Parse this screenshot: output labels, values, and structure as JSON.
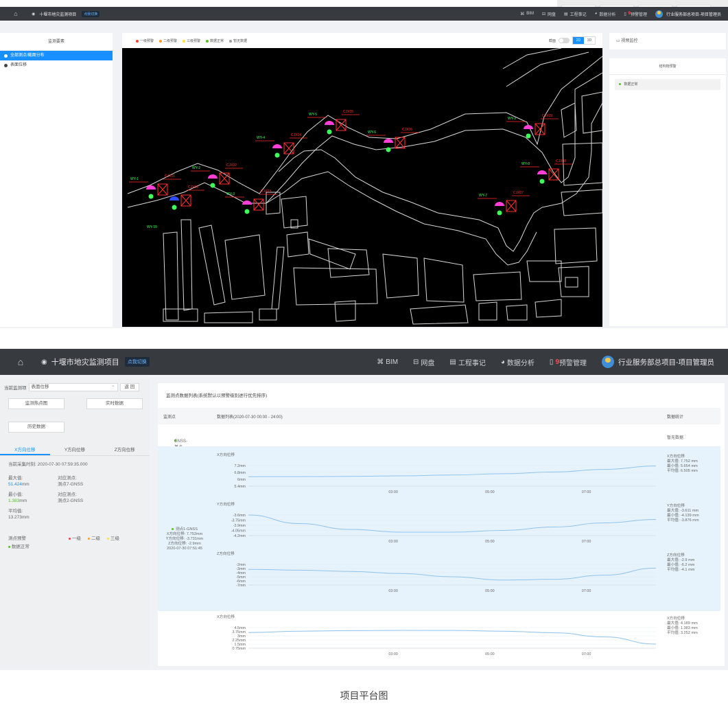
{
  "topbar": {
    "project": "十堰市地灾监测项目",
    "switch": "点我切换",
    "nav": [
      {
        "icon": "bim-icon",
        "glyph": "⌘",
        "label": "BIM"
      },
      {
        "icon": "cloud-disk-icon",
        "glyph": "⊟",
        "label": "网盘"
      },
      {
        "icon": "calendar-icon",
        "glyph": "▤",
        "label": "工程事记"
      },
      {
        "icon": "pie-chart-icon",
        "glyph": "◕",
        "label": "数据分析"
      },
      {
        "icon": "bell-icon",
        "glyph": "▯",
        "label": "预警管理",
        "badge": "9"
      }
    ],
    "user": "行业服务部总项目-项目管理员"
  },
  "screen1": {
    "left_header": "监测要素",
    "left_items": [
      {
        "label": "全部测点/截面分布",
        "active": true
      },
      {
        "label": "表面位移",
        "active": false
      }
    ],
    "legend": [
      {
        "label": "一级预警",
        "color": "#ff3b3b"
      },
      {
        "label": "二级预警",
        "color": "#ff9c1a"
      },
      {
        "label": "三级预警",
        "color": "#ffe23a"
      },
      {
        "label": "数据正常",
        "color": "#52c41a"
      },
      {
        "label": "暂无数据",
        "color": "#9aa0a6"
      }
    ],
    "section_toggle": "截面",
    "view_2d": "2D",
    "view_3d": "3D",
    "video": "视频监控",
    "right_panel_title": "结构物预警",
    "right_item": "数据正常",
    "map_points": [
      {
        "wy": "WY-1",
        "cj": "CJX01"
      },
      {
        "wy": "WY-2",
        "cj": "CJX02"
      },
      {
        "wy": "WY-3",
        "cj": "CJX03"
      },
      {
        "wy": "WY-4",
        "cj": "CJX04"
      },
      {
        "wy": "WY-5",
        "cj": "CJX05"
      },
      {
        "wy": "WY-6",
        "cj": "CJX06"
      },
      {
        "wy": "WY-7",
        "cj": "CJX07"
      },
      {
        "wy": "WY-8",
        "cj": "CJX08"
      },
      {
        "wy": "WY-9",
        "cj": "CJX09"
      },
      {
        "wy": "",
        "cj": "CJX10"
      },
      {
        "wy": "WY-10",
        "cj": ""
      }
    ]
  },
  "screen2": {
    "current_label": "当前监测项",
    "current_value": "表面位移",
    "back": "返 回",
    "btn_heatmap": "监测热点图",
    "btn_realtime": "实时数据",
    "btn_history": "历史数据",
    "tabs": [
      "X方向位移",
      "Y方向位移",
      "Z方向位移"
    ],
    "collect_time_label": "当前采集时刻:",
    "collect_time": "2020-07-30 07:59:35.000",
    "max_label": "最大值:",
    "max_value": "51.424",
    "max_unit": "mm",
    "max_point_label": "对应测点:",
    "max_point": "测点7-GNSS",
    "min_label": "最小值:",
    "min_value": "1.383",
    "min_unit": "mm",
    "min_point_label": "对应测点:",
    "min_point": "测点2-GNSS",
    "avg_label": "平均值:",
    "avg_value": "13.273mm",
    "warn_label": "测点预警",
    "warn_levels": [
      {
        "label": "一级",
        "color": "#ff3b3b"
      },
      {
        "label": "二级",
        "color": "#ff9c1a"
      },
      {
        "label": "三级",
        "color": "#ffe23a"
      }
    ],
    "normal": "数据正常",
    "main_title": "监测点数据列表(系统默认以预警级别进行优先排序)",
    "col_point": "监测点",
    "col_data": "数据列表(2020-07-30 00:00 - 24:00)",
    "col_stat": "数据统计",
    "gnss_base": "GNSS-基点",
    "no_data": "暂无数据",
    "point1": {
      "name": "测点1-GNSS",
      "x": "X方向位移: 7.752mm",
      "y": "Y方向位移: -3.731mm",
      "z": "Z方向位移: -2.9mm",
      "time": "2020-07-30 07:51:45"
    }
  },
  "chart_data": [
    {
      "type": "line",
      "title": "X方向位移",
      "x": [
        "00:00",
        "01:00",
        "02:00",
        "03:00",
        "04:00",
        "05:00",
        "06:00",
        "07:00",
        "07:51"
      ],
      "xticks": [
        "03:00",
        "05:00",
        "07:00"
      ],
      "yticks": [
        "7.2mm",
        "6.8mm",
        "6mm",
        "5.4mm"
      ],
      "ylim": [
        5.4,
        7.8
      ],
      "series": [
        {
          "values": [
            6.505,
            6.51,
            6.54,
            6.6,
            6.7,
            6.85,
            7.05,
            7.35,
            7.752
          ]
        }
      ],
      "stats": {
        "title": "X方向位移",
        "max": "最大值: 7.752 mm",
        "min": "最小值: 5.654 mm",
        "avg": "平均值: 6.505 mm"
      }
    },
    {
      "type": "line",
      "title": "Y方向位移",
      "x": [
        "00:00",
        "01:00",
        "02:00",
        "03:00",
        "04:00",
        "05:00",
        "06:00",
        "07:00",
        "07:51"
      ],
      "xticks": [
        "03:00",
        "05:00",
        "07:00"
      ],
      "yticks": [
        "-3.6mm",
        "-3.75mm",
        "-3.9mm",
        "-4.05mm",
        "-4.2mm"
      ],
      "ylim": [
        -4.2,
        -3.6
      ],
      "series": [
        {
          "values": [
            -3.6,
            -3.85,
            -4.02,
            -4.1,
            -4.1,
            -4.05,
            -3.95,
            -3.83,
            -3.73
          ]
        }
      ],
      "stats": {
        "title": "Y方向位移",
        "max": "最大值: -3.611 mm",
        "min": "最小值: -4.139 mm",
        "avg": "平均值: -3.876 mm"
      }
    },
    {
      "type": "line",
      "title": "Z方向位移",
      "x": [
        "00:00",
        "01:00",
        "02:00",
        "03:00",
        "04:00",
        "05:00",
        "06:00",
        "07:00",
        "07:51"
      ],
      "xticks": [
        "03:00",
        "05:00",
        "07:00"
      ],
      "yticks": [
        "-2mm",
        "-3mm",
        "-4mm",
        "-5mm",
        "-6mm",
        "-7mm"
      ],
      "ylim": [
        -7,
        -2
      ],
      "series": [
        {
          "values": [
            -3.2,
            -3.4,
            -3.7,
            -4.2,
            -5.0,
            -5.8,
            -5.6,
            -4.6,
            -2.9
          ]
        }
      ],
      "stats": {
        "title": "Z方向位移",
        "max": "最大值: -2.9 mm",
        "min": "最小值: -6.2 mm",
        "avg": "平均值: -4.1 mm"
      }
    },
    {
      "type": "line",
      "title": "X方向位移",
      "x": [
        "00:00",
        "01:00",
        "02:00",
        "03:00",
        "04:00",
        "05:00",
        "06:00",
        "07:00",
        "07:51"
      ],
      "xticks": [
        "03:00",
        "05:00",
        "07:00"
      ],
      "yticks": [
        "4.5mm",
        "3.75mm",
        "3mm",
        "2.25mm",
        "1.5mm",
        "0.75mm"
      ],
      "ylim": [
        0.75,
        4.5
      ],
      "series": [
        {
          "values": [
            3.6,
            3.85,
            3.95,
            4.0,
            3.98,
            3.85,
            3.55,
            2.8,
            1.5
          ]
        }
      ],
      "stats": {
        "title": "X方向位移",
        "max": "最大值: 4.189 mm",
        "min": "最小值: 1.383 mm",
        "avg": "平均值: 3.252 mm"
      }
    }
  ],
  "caption": "项目平台图"
}
